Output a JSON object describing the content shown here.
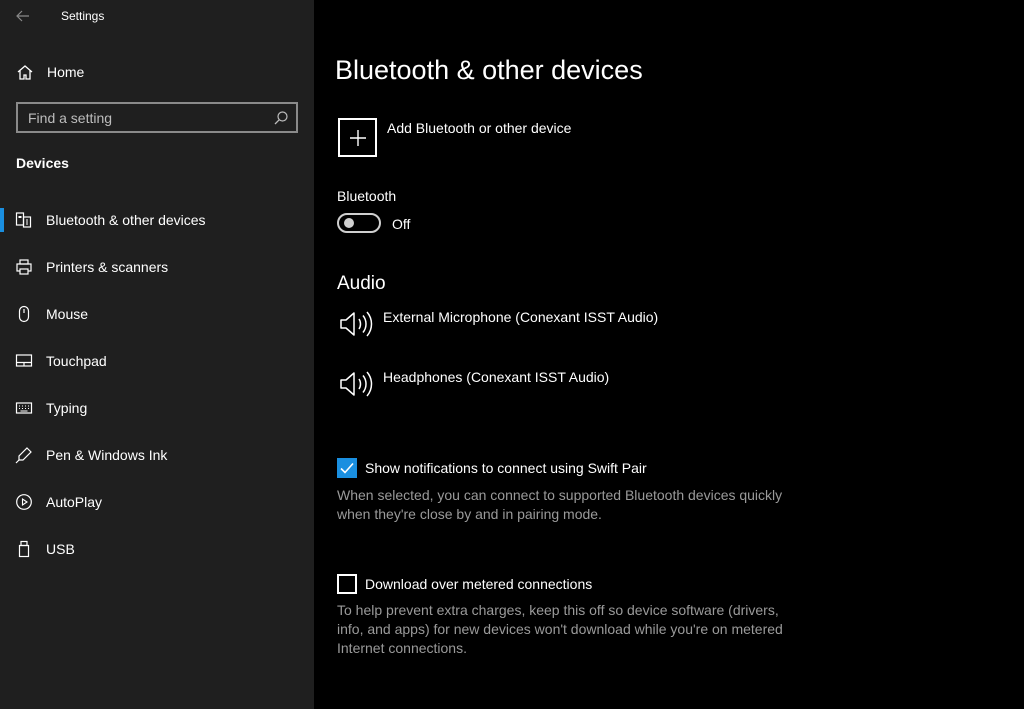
{
  "window": {
    "title": "Settings"
  },
  "sidebar": {
    "home_label": "Home",
    "search_placeholder": "Find a setting",
    "section_title": "Devices",
    "items": [
      {
        "label": "Bluetooth & other devices",
        "icon": "bluetooth-devices-icon",
        "active": true
      },
      {
        "label": "Printers & scanners",
        "icon": "printer-icon"
      },
      {
        "label": "Mouse",
        "icon": "mouse-icon"
      },
      {
        "label": "Touchpad",
        "icon": "touchpad-icon"
      },
      {
        "label": "Typing",
        "icon": "keyboard-icon"
      },
      {
        "label": "Pen & Windows Ink",
        "icon": "pen-icon"
      },
      {
        "label": "AutoPlay",
        "icon": "autoplay-icon"
      },
      {
        "label": "USB",
        "icon": "usb-icon"
      }
    ]
  },
  "main": {
    "title": "Bluetooth & other devices",
    "add_device_label": "Add Bluetooth or other device",
    "bluetooth": {
      "label": "Bluetooth",
      "state": "Off"
    },
    "audio": {
      "title": "Audio",
      "devices": [
        "External Microphone (Conexant ISST Audio)",
        "Headphones (Conexant ISST Audio)"
      ]
    },
    "swift_pair": {
      "label": "Show notifications to connect using Swift Pair",
      "checked": true,
      "description": "When selected, you can connect to supported Bluetooth devices quickly when they're close by and in pairing mode."
    },
    "metered": {
      "label": "Download over metered connections",
      "checked": false,
      "description": "To help prevent extra charges, keep this off so device software (drivers, info, and apps) for new devices won't download while you're on metered Internet connections."
    }
  },
  "colors": {
    "accent": "#1a8fe0",
    "sidebar_bg": "#1f1f1f",
    "main_bg": "#000000",
    "secondary_text": "#9a9a9a"
  }
}
